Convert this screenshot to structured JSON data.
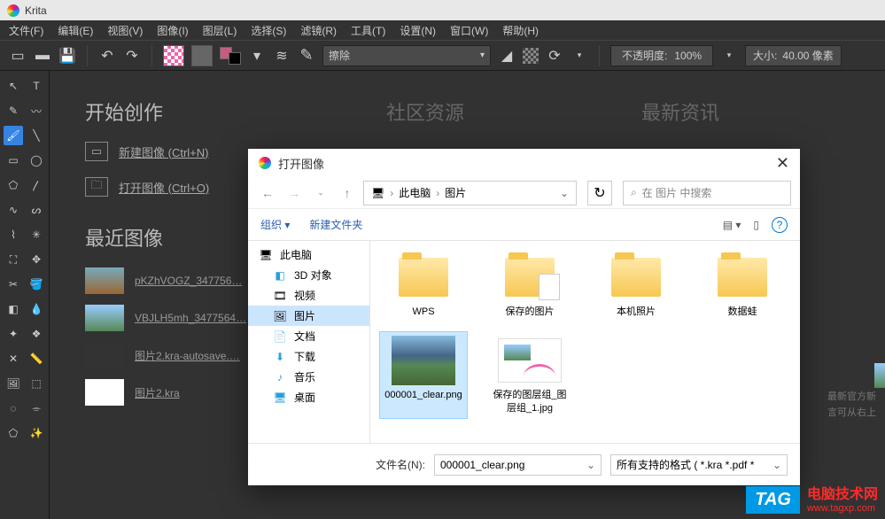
{
  "app": {
    "title": "Krita"
  },
  "menu": [
    "文件(F)",
    "编辑(E)",
    "视图(V)",
    "图像(I)",
    "图层(L)",
    "选择(S)",
    "滤镜(R)",
    "工具(T)",
    "设置(N)",
    "窗口(W)",
    "帮助(H)"
  ],
  "toolbar": {
    "brush_mode": "擦除",
    "opacity_label": "不透明度:",
    "opacity_value": "100%",
    "size_label": "大小:",
    "size_value": "40.00 像素"
  },
  "start": {
    "create_title": "开始创作",
    "new_label": "新建图像 (Ctrl+N)",
    "open_label": "打开图像 (Ctrl+O)",
    "recent_title": "最近图像",
    "recent": [
      "pKZhVOGZ_347756…",
      "VBJLH5mh_3477564…",
      "图片2.kra-autosave.…",
      "图片2.kra"
    ],
    "community_title": "社区资源",
    "news_title": "最新资讯",
    "news_text1": "最新官方新",
    "news_text2": "言可从右上"
  },
  "dialog": {
    "title": "打开图像",
    "path_root": "此电脑",
    "path_cur": "图片",
    "search_placeholder": "在 图片 中搜索",
    "organize": "组织",
    "new_folder": "新建文件夹",
    "sidebar": {
      "this_pc": "此电脑",
      "items": [
        "3D 对象",
        "视频",
        "图片",
        "文档",
        "下载",
        "音乐",
        "桌面"
      ]
    },
    "files": [
      {
        "name": "WPS",
        "type": "folder"
      },
      {
        "name": "保存的图片",
        "type": "folder"
      },
      {
        "name": "本机照片",
        "type": "folder"
      },
      {
        "name": "数据蛙",
        "type": "folder"
      },
      {
        "name": "000001_clear.png",
        "type": "image",
        "selected": true
      },
      {
        "name": "保存的图层组_图层组_1.jpg",
        "type": "image"
      }
    ],
    "filename_label": "文件名(N):",
    "filename_value": "000001_clear.png",
    "filetype": "所有支持的格式 ( *.kra *.pdf *"
  },
  "watermark": {
    "tag": "TAG",
    "text": "电脑技术网",
    "url": "www.tagxp.com"
  }
}
